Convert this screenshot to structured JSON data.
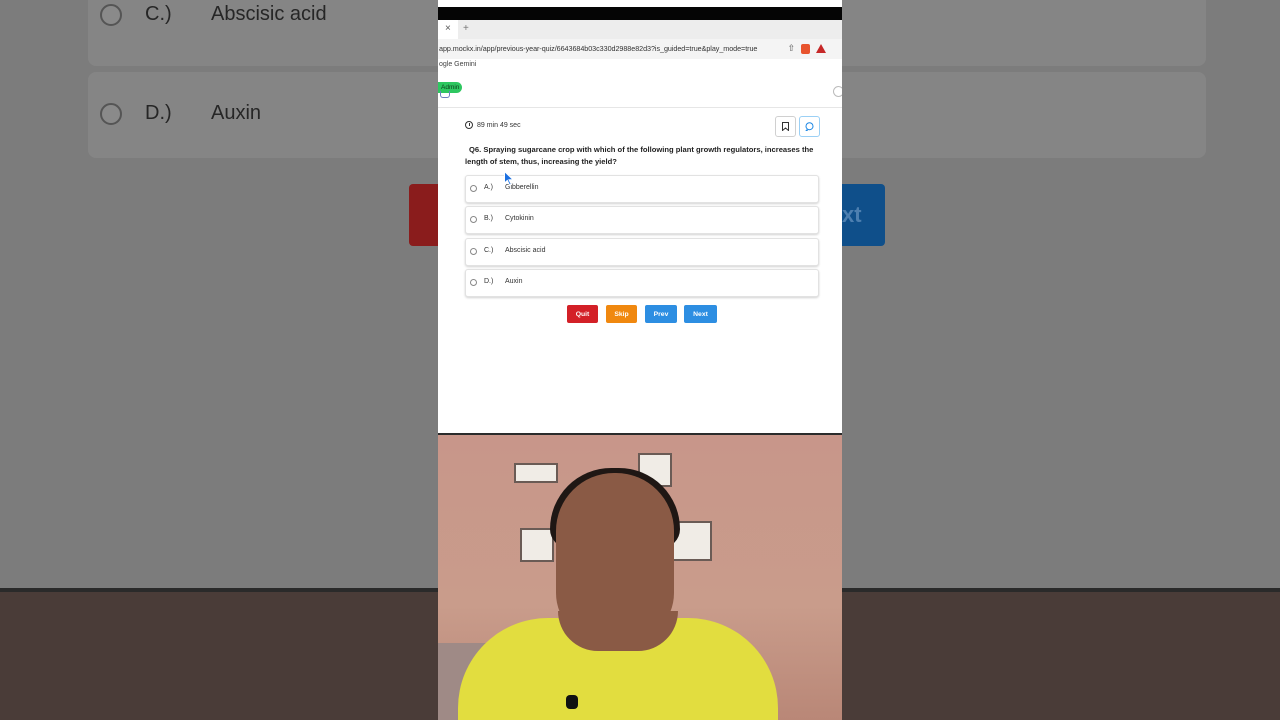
{
  "background_zoom": {
    "options": [
      {
        "letter": "C.)",
        "text": "Abscisic acid"
      },
      {
        "letter": "D.)",
        "text": "Auxin"
      }
    ],
    "next_partial": "xt"
  },
  "browser": {
    "tab_close": "×",
    "tab_new": "+",
    "url": "app.mockx.in/app/previous-year-quiz/6643684b03c330d2988e82d3?is_guided=true&play_mode=true",
    "bookmark": "ogle Gemini"
  },
  "app": {
    "role_badge": "Admin"
  },
  "quiz": {
    "timer": "89 min 49 sec",
    "question_number": "Q6.",
    "question_text": "Spraying sugarcane crop with which of the following plant growth regulators, increases the length of stem, thus, increasing the yield?",
    "options": [
      {
        "letter": "A.)",
        "text": "Gibberellin"
      },
      {
        "letter": "B.)",
        "text": "Cytokinin"
      },
      {
        "letter": "C.)",
        "text": "Abscisic acid"
      },
      {
        "letter": "D.)",
        "text": "Auxin"
      }
    ],
    "buttons": {
      "quit": "Quit",
      "skip": "Skip",
      "prev": "Prev",
      "next": "Next"
    }
  },
  "colors": {
    "quit": "#d32027",
    "skip": "#f0880f",
    "nav": "#2d8ee2",
    "badge": "#2ec760"
  }
}
